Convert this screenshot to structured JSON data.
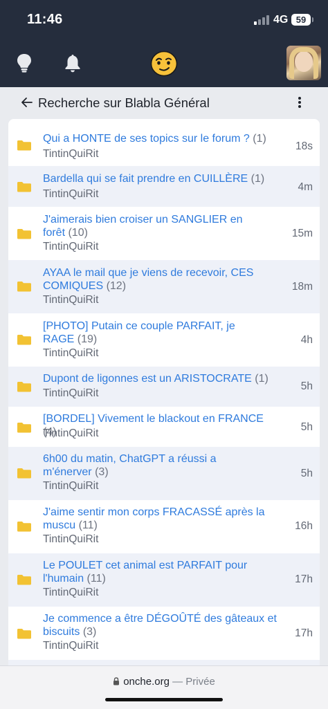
{
  "status_bar": {
    "time": "11:46",
    "network": "4G",
    "battery": "59"
  },
  "nav": {
    "bulb_icon": "lightbulb-icon",
    "bell_icon": "bell-icon",
    "logo_icon": "smiley-logo-icon",
    "avatar": "user-avatar"
  },
  "header": {
    "title": "Recherche sur Blabla Général"
  },
  "topics": [
    {
      "line1": "Qui a HONTE de ses topics sur le forum ?",
      "line1_count": "(1)",
      "line2": "",
      "line2_count": "",
      "author": "TintinQuiRit",
      "time": "18s"
    },
    {
      "line1": "Bardella qui se fait prendre en CUILLÈRE",
      "line1_count": "(1)",
      "line2": "",
      "line2_count": "",
      "author": "TintinQuiRit",
      "time": "4m"
    },
    {
      "line1": "J'aimerais bien croiser un SANGLIER en",
      "line1_count": "",
      "line2": "forêt",
      "line2_count": "(10)",
      "author": "TintinQuiRit",
      "time": "15m"
    },
    {
      "line1": "AYAA le mail que je viens de recevoir, CES",
      "line1_count": "",
      "line2": "COMIQUES",
      "line2_count": "(12)",
      "author": "TintinQuiRit",
      "time": "18m"
    },
    {
      "line1": "[PHOTO] Putain ce couple PARFAIT, je",
      "line1_count": "",
      "line2": "RAGE",
      "line2_count": "(19)",
      "author": "TintinQuiRit",
      "time": "4h"
    },
    {
      "line1": "Dupont de ligonnes est un ARISTOCRATE",
      "line1_count": "(1)",
      "line2": "",
      "line2_count": "",
      "author": "TintinQuiRit",
      "time": "5h"
    },
    {
      "line1": "[BORDEL] Vivement le blackout en FRANCE",
      "line1_count": "(4)",
      "line2": "",
      "line2_count": "",
      "author": "TintinQuiRit",
      "time": "5h"
    },
    {
      "line1": "6h00 du matin, ChatGPT a réussi a",
      "line1_count": "",
      "line2": "m'énerver",
      "line2_count": "(3)",
      "author": "TintinQuiRit",
      "time": "5h"
    },
    {
      "line1": "J'aime sentir mon corps FRACASSÉ après la",
      "line1_count": "",
      "line2": "muscu",
      "line2_count": "(11)",
      "author": "TintinQuiRit",
      "time": "16h"
    },
    {
      "line1": "Le POULET cet animal est PARFAIT pour",
      "line1_count": "",
      "line2": "l'humain",
      "line2_count": "(11)",
      "author": "TintinQuiRit",
      "time": "17h"
    },
    {
      "line1": "Je commence a être DÉGOÛTÉ des gâteaux et",
      "line1_count": "",
      "line2": "biscuits",
      "line2_count": "(3)",
      "author": "TintinQuiRit",
      "time": "17h"
    }
  ],
  "browser": {
    "domain": "onche.org",
    "separator": "—",
    "mode": "Privée"
  },
  "colors": {
    "topbar": "#252d3d",
    "link": "#2f7bdd",
    "folder": "#f2c233",
    "row_alt": "#eef1f8"
  }
}
